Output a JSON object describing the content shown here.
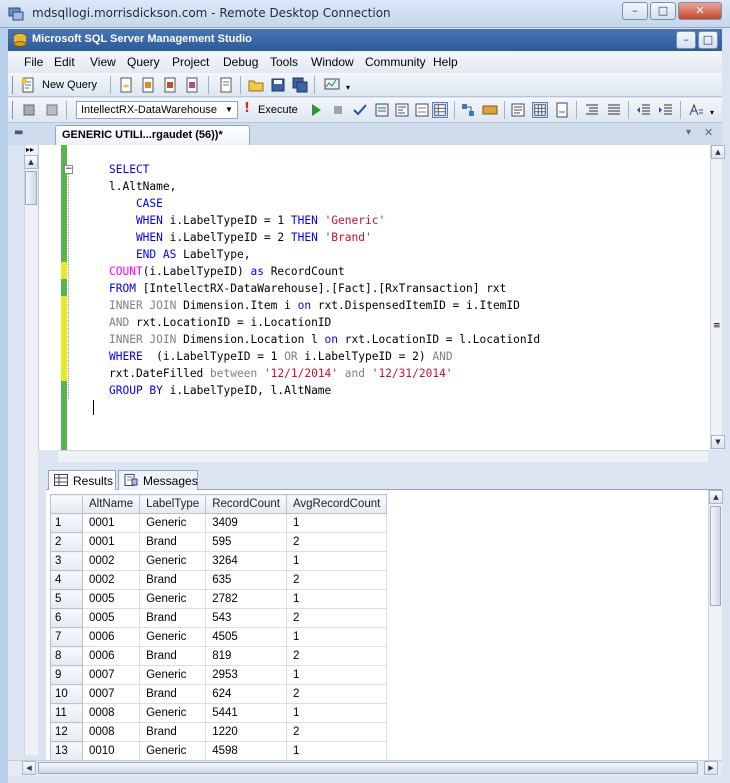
{
  "rdp_window": {
    "title": "mdsqllogi.morrisdickson.com - Remote Desktop Connection",
    "buttons": [
      "–",
      "□",
      "✕"
    ]
  },
  "ssms": {
    "title": "Microsoft SQL Server Management Studio",
    "window_buttons": [
      "–",
      "□"
    ]
  },
  "menu": [
    "File",
    "Edit",
    "View",
    "Query",
    "Project",
    "Debug",
    "Tools",
    "Window",
    "Community",
    "Help"
  ],
  "toolbar1": {
    "new_query_label": "New Query"
  },
  "toolbar2": {
    "database": "IntellectRX-DataWarehouse",
    "execute_label": "Execute"
  },
  "doc_tab": {
    "label": "GENERIC UTILI...rgaudet (56))*"
  },
  "left_strip": {
    "toggle": "▸▸"
  },
  "sql": [
    [
      {
        "t": "SELECT",
        "c": "kw"
      }
    ],
    [
      {
        "t": "l.AltName,",
        "c": ""
      }
    ],
    [
      {
        "t": "    CASE",
        "c": "kw"
      }
    ],
    [
      {
        "t": "    WHEN ",
        "c": "kw"
      },
      {
        "t": "i.LabelTypeID = 1 ",
        "c": ""
      },
      {
        "t": "THEN ",
        "c": "kw"
      },
      {
        "t": "'Generic'",
        "c": "st"
      }
    ],
    [
      {
        "t": "    WHEN ",
        "c": "kw"
      },
      {
        "t": "i.LabelTypeID = 2 ",
        "c": ""
      },
      {
        "t": "THEN ",
        "c": "kw"
      },
      {
        "t": "'Brand'",
        "c": "st"
      }
    ],
    [
      {
        "t": "    END AS ",
        "c": "kw"
      },
      {
        "t": "LabelType,",
        "c": ""
      }
    ],
    [
      {
        "t": "COUNT",
        "c": "fn"
      },
      {
        "t": "(i.LabelTypeID) ",
        "c": ""
      },
      {
        "t": "as ",
        "c": "kw"
      },
      {
        "t": "RecordCount",
        "c": ""
      }
    ],
    [
      {
        "t": "FROM ",
        "c": "kw"
      },
      {
        "t": "[IntellectRX-DataWarehouse].[Fact].[RxTransaction] rxt",
        "c": ""
      }
    ],
    [
      {
        "t": "INNER JOIN ",
        "c": "gr"
      },
      {
        "t": "Dimension.Item i ",
        "c": ""
      },
      {
        "t": "on ",
        "c": "kw"
      },
      {
        "t": "rxt.DispensedItemID = i.ItemID",
        "c": ""
      }
    ],
    [
      {
        "t": "AND ",
        "c": "gr"
      },
      {
        "t": "rxt.LocationID = i.LocationID",
        "c": ""
      }
    ],
    [
      {
        "t": "INNER JOIN ",
        "c": "gr"
      },
      {
        "t": "Dimension.Location l ",
        "c": ""
      },
      {
        "t": "on ",
        "c": "kw"
      },
      {
        "t": "rxt.LocationID = l.LocationId",
        "c": ""
      }
    ],
    [
      {
        "t": "WHERE  ",
        "c": "kw"
      },
      {
        "t": "(i.LabelTypeID = 1 ",
        "c": ""
      },
      {
        "t": "OR ",
        "c": "gr"
      },
      {
        "t": "i.LabelTypeID = 2) ",
        "c": ""
      },
      {
        "t": "AND",
        "c": "gr"
      }
    ],
    [
      {
        "t": "rxt.DateFilled ",
        "c": ""
      },
      {
        "t": "between ",
        "c": "gr"
      },
      {
        "t": "'12/1/2014'",
        "c": "st"
      },
      {
        "t": " and ",
        "c": "gr"
      },
      {
        "t": "'12/31/2014'",
        "c": "st"
      }
    ],
    [
      {
        "t": "GROUP BY ",
        "c": "kw"
      },
      {
        "t": "i.LabelTypeID, l.AltName",
        "c": ""
      }
    ]
  ],
  "result_tabs": [
    "Results",
    "Messages"
  ],
  "grid": {
    "columns": [
      "AltName",
      "LabelType",
      "RecordCount",
      "AvgRecordCount"
    ],
    "rows": [
      [
        "1",
        "0001",
        "Generic",
        "3409",
        "1"
      ],
      [
        "2",
        "0001",
        "Brand",
        "595",
        "2"
      ],
      [
        "3",
        "0002",
        "Generic",
        "3264",
        "1"
      ],
      [
        "4",
        "0002",
        "Brand",
        "635",
        "2"
      ],
      [
        "5",
        "0005",
        "Generic",
        "2782",
        "1"
      ],
      [
        "6",
        "0005",
        "Brand",
        "543",
        "2"
      ],
      [
        "7",
        "0006",
        "Generic",
        "4505",
        "1"
      ],
      [
        "8",
        "0006",
        "Brand",
        "819",
        "2"
      ],
      [
        "9",
        "0007",
        "Generic",
        "2953",
        "1"
      ],
      [
        "10",
        "0007",
        "Brand",
        "624",
        "2"
      ],
      [
        "11",
        "0008",
        "Generic",
        "5441",
        "1"
      ],
      [
        "12",
        "0008",
        "Brand",
        "1220",
        "2"
      ],
      [
        "13",
        "0010",
        "Generic",
        "4598",
        "1"
      ]
    ]
  },
  "colors": {
    "keyword": "#0000ff",
    "string": "#c8102e",
    "gray": "#808080",
    "function": "#ff00ff",
    "change_bar": "#5ab64a"
  }
}
